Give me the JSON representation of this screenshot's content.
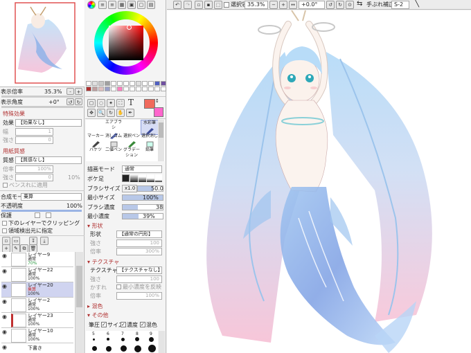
{
  "navigator": {
    "zoom_label": "表示倍率",
    "zoom_value": "35.3%",
    "angle_label": "表示角度",
    "angle_value": "+0°"
  },
  "effects": {
    "section_title": "特殊効果",
    "effect_label": "効果",
    "effect_value": "【効果なし】",
    "width_label": "幅",
    "width_value": "1",
    "strength_label": "強さ",
    "strength_value": "0"
  },
  "paper": {
    "section_title": "用紙質感",
    "texture_label": "質感",
    "texture_value": "【質感なし】",
    "scale_label": "倍率",
    "scale_value": "100%",
    "strength_label": "強さ",
    "strength_value": "0",
    "strength_pct": "10%",
    "checkbox_label": "ベンスれに適用"
  },
  "layer_props": {
    "blend_label": "合成モード",
    "blend_value": "乗算",
    "opacity_label": "不透明度",
    "opacity_value": "100%",
    "protect_label": "保護",
    "clip_label": "下のレイヤーでクリッピング",
    "source_label": "領域検出元に指定"
  },
  "layers": [
    {
      "name": "レイヤー9",
      "mode": "通常",
      "opacity": "70%",
      "opacity_color": "#2a9a40"
    },
    {
      "name": "レイヤー22",
      "mode": "通常",
      "opacity": "100%"
    },
    {
      "name": "レイヤー20",
      "mode": "乗算",
      "opacity": "100%",
      "mode_color": "#c03030"
    },
    {
      "name": "レイヤー2",
      "mode": "通常",
      "opacity": "100%"
    },
    {
      "name": "レイヤー23",
      "mode": "通常",
      "opacity": "100%"
    },
    {
      "name": "レイヤー10",
      "mode": "通常",
      "opacity": "100%"
    },
    {
      "name": "下書き",
      "mode": "",
      "opacity": ""
    }
  ],
  "color": {
    "fg": "#f06a5c",
    "bg": "#ff66cc",
    "palette": [
      "#ffffff",
      "#e0e0e0",
      "#c8c8c8",
      "#a0a0a0",
      "#ffffff",
      "#ffffff",
      "#ffffff",
      "#ffffff",
      "#e0e0e0",
      "#ffffff",
      "#ffffff",
      "#5060c0",
      "#7050a0",
      "#a03070",
      "#b03030",
      "#c0a0a0",
      "#e0c0c0",
      "#9aa0c8",
      "#ffffff",
      "#ff80c0",
      "#ffffff",
      "#ffffff",
      "#ffffff",
      "#ffffff",
      "#ffffff",
      "#ffffff",
      "#ffffff",
      "#ffffff"
    ]
  },
  "tools": {
    "row1": [
      "エアブラシ",
      "水彩筆"
    ],
    "row2": [
      "マーカー",
      "消しゴム",
      "選択ペン",
      "選択消し"
    ],
    "row3": [
      "バケツ",
      "二値ペン",
      "グラデーション",
      "鉛筆"
    ]
  },
  "brush": {
    "mode_label": "描画モード",
    "mode_value": "通常",
    "blur_label": "ボケ足",
    "size_label": "ブラシサイズ",
    "size_mult": "x1.0",
    "size_value": "50.0",
    "min_size_label": "最小サイズ",
    "min_size_value": "100%",
    "density_label": "ブラシ濃度",
    "density_value": "38",
    "min_density_label": "最小濃度",
    "min_density_value": "39%",
    "shape_section": "形状",
    "shape_label": "形状",
    "shape_value": "【通常の円形】",
    "shape_strength_label": "強さ",
    "shape_strength_value": "100",
    "shape_scale_label": "倍率",
    "shape_scale_value": "300%",
    "texture_section": "テクスチャ",
    "texture_label": "テクスチャ",
    "texture_value": "【テクスチャなし】",
    "tex_strength_label": "強さ",
    "tex_strength_value": "100",
    "tex_blur_label": "かすれ",
    "tex_invert_label": "最小濃度を反映",
    "tex_scale_label": "倍率",
    "tex_scale_value": "100%",
    "mix_section": "混色",
    "other_section": "その他",
    "pressure_label": "筆圧",
    "pressure_size": "サイズ",
    "pressure_density": "濃度",
    "pressure_mix": "混色",
    "dot_sizes": [
      "5",
      "6",
      "7",
      "8",
      "9"
    ]
  },
  "toolbar": {
    "selection_label": "選択領域",
    "zoom_value": "35.3%",
    "angle_value": "+0.0°",
    "stabilizer_label": "手ぶれ補正",
    "stabilizer_value": "S-2"
  }
}
